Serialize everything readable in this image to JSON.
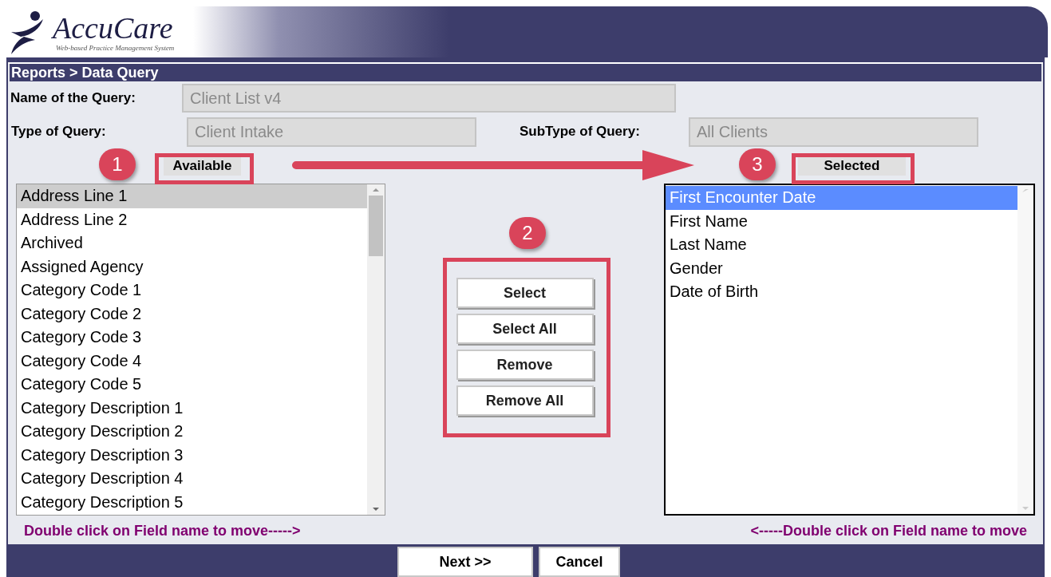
{
  "header": {
    "logo": "AccuCare",
    "tagline": "Web-based Practice Management System"
  },
  "breadcrumb": "Reports > Data Query",
  "fields": [
    {
      "label": "Name of the Query:",
      "value": "Client List v4"
    },
    {
      "label": "Type of Query:",
      "value": "Client Intake"
    },
    {
      "label": "SubType of Query:",
      "value": "All Clients"
    }
  ],
  "available": {
    "heading": "Available",
    "focused": false,
    "hint": "Double click on Field name to move----->",
    "items": [
      {
        "label": "Address Line 1",
        "selected": true
      },
      {
        "label": "Address Line 2",
        "selected": false
      },
      {
        "label": "Archived",
        "selected": false
      },
      {
        "label": "Assigned Agency",
        "selected": false
      },
      {
        "label": "Category Code 1",
        "selected": false
      },
      {
        "label": "Category Code 2",
        "selected": false
      },
      {
        "label": "Category Code 3",
        "selected": false
      },
      {
        "label": "Category Code 4",
        "selected": false
      },
      {
        "label": "Category Code 5",
        "selected": false
      },
      {
        "label": "Category Description 1",
        "selected": false
      },
      {
        "label": "Category Description 2",
        "selected": false
      },
      {
        "label": "Category Description 3",
        "selected": false
      },
      {
        "label": "Category Description 4",
        "selected": false
      },
      {
        "label": "Category Description 5",
        "selected": false
      }
    ]
  },
  "actions": [
    "Select",
    "Select All",
    "Remove",
    "Remove All"
  ],
  "selected_list": {
    "heading": "Selected",
    "focused": true,
    "hint": "<-----Double click on Field name to move",
    "items": [
      {
        "label": "First Encounter Date",
        "selected": true
      },
      {
        "label": "First Name",
        "selected": false
      },
      {
        "label": "Last Name",
        "selected": false
      },
      {
        "label": "Gender",
        "selected": false
      },
      {
        "label": "Date of Birth",
        "selected": false
      }
    ]
  },
  "annotations": [
    {
      "number": "1"
    },
    {
      "number": "2"
    },
    {
      "number": "3"
    }
  ],
  "footer_buttons": [
    "Next >>",
    "Cancel"
  ]
}
